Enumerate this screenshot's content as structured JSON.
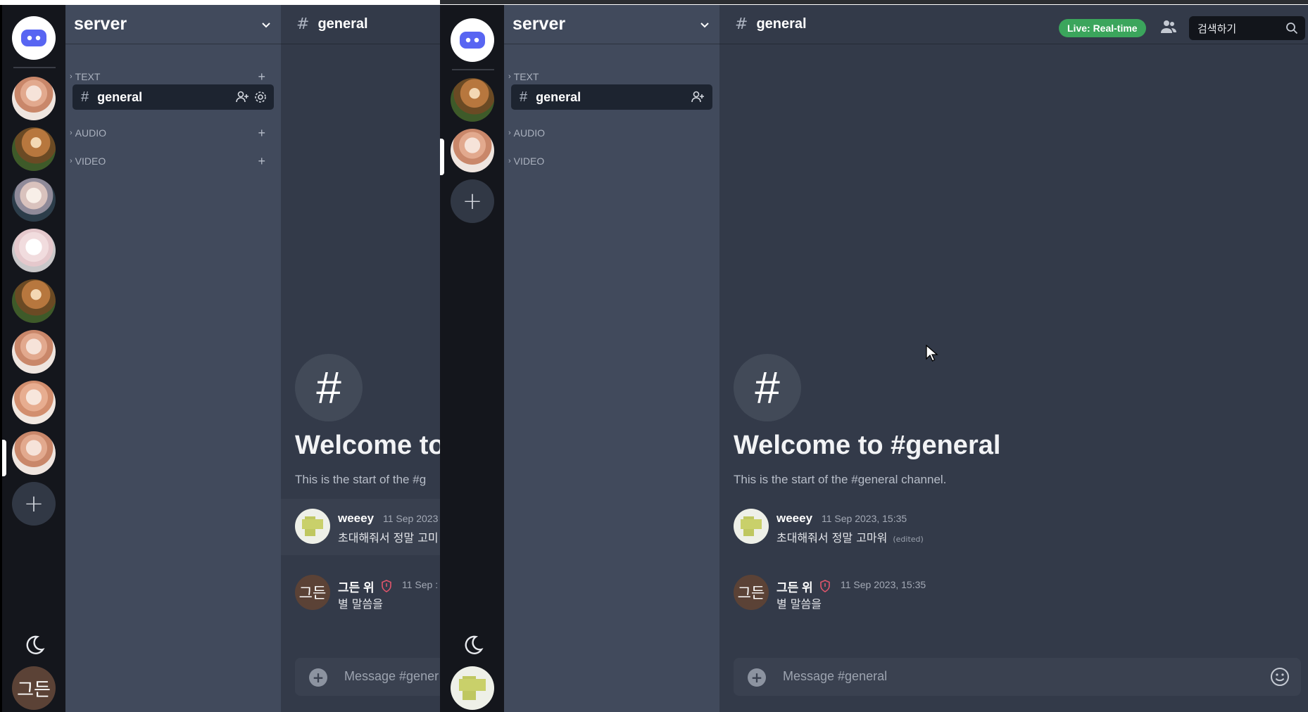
{
  "server": {
    "name": "server",
    "categories": [
      {
        "label": "TEXT"
      },
      {
        "label": "AUDIO"
      },
      {
        "label": "VIDEO"
      }
    ],
    "channel": {
      "name": "general"
    }
  },
  "header": {
    "channel_name": "general",
    "live_badge": "Live: Real-time",
    "search_placeholder": "검색하기"
  },
  "welcome": {
    "title": "Welcome to #general",
    "subtitle": "This is the start of the #general channel."
  },
  "messages": [
    {
      "author": "weeey",
      "timestamp": "11 Sep 2023, 15:35",
      "text": "초대해줘서 정말 고마워",
      "edited": "(edited)",
      "avatar": "pixel"
    },
    {
      "author": "그든 위",
      "timestamp": "11 Sep 2023, 15:35",
      "text": "별 말씀을",
      "avatar_text": "그든"
    }
  ],
  "composer": {
    "placeholder": "Message #general"
  },
  "user": {
    "avatar_text": "그든"
  },
  "left_window": {
    "welcome_title_clipped": "Welcome to",
    "welcome_sub_clipped": "This is the start of the #g",
    "msg1_stamp_clipped": "11 Sep 2023",
    "msg1_text_clipped": "초대해줘서 정말 고미",
    "msg2_stamp_clipped": "11 Sep :",
    "composer_clipped": "Message #gener"
  },
  "icons": {
    "brand": "discord-logo-icon",
    "theme": "moon-icon",
    "add_server": "plus-icon",
    "members": "members-icon",
    "search": "search-icon",
    "emoji": "emoji-icon",
    "invite": "add-user-icon",
    "settings": "gear-icon",
    "role": "shield-icon"
  },
  "colors": {
    "rail_bg": "#14161c",
    "sidebar_bg": "#414a5c",
    "main_bg": "#333a49",
    "accent_live": "#3ba55c",
    "brand_blue": "#5865f2",
    "role_red": "#e0556b"
  }
}
